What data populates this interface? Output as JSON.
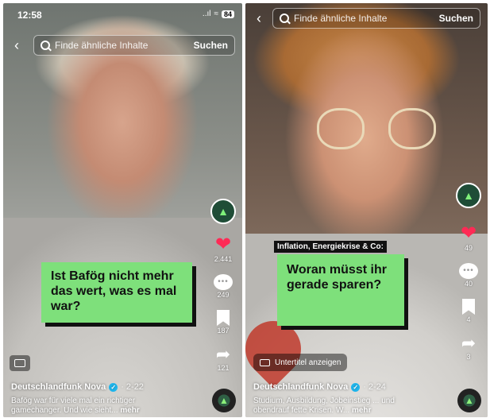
{
  "left": {
    "status": {
      "time": "12:58",
      "signal": "..ıl",
      "wifi": "≈",
      "battery": "84"
    },
    "search": {
      "placeholder": "Finde ähnliche Inhalte",
      "button": "Suchen"
    },
    "caption": "Ist Bafög nicht mehr das wert, was es mal war?",
    "actions": {
      "likes": "2.441",
      "comments": "249",
      "saves": "187",
      "shares": "121"
    },
    "author": "Deutschlandfunk Nova",
    "date": "· 2-22",
    "description": "Bafög war für viele mal ein richtiger gamechanger. Und wie sieht...",
    "more": "mehr"
  },
  "right": {
    "search": {
      "placeholder": "Finde ähnliche Inhalte",
      "button": "Suchen"
    },
    "topic": "Inflation, Energiekrise & Co:",
    "caption": "Woran müsst ihr gerade sparen?",
    "actions": {
      "likes": "49",
      "comments": "40",
      "saves": "4",
      "shares": "3"
    },
    "subtitles": "Untertitel anzeigen",
    "author": "Deutschlandfunk Nova",
    "date": "· 2-24",
    "description": "Studium, Ausbildung, Jobeinstieg ... und obendrauf fette Krisen. W...",
    "more": "mehr"
  },
  "icons": {
    "back": "back-chevron-icon",
    "search": "magnifier-icon",
    "like": "heart-icon",
    "comment": "speech-bubble-icon",
    "save": "bookmark-icon",
    "share": "share-arrow-icon",
    "subtitles": "closed-caption-icon",
    "verified": "verified-badge-icon"
  },
  "colors": {
    "caption_green": "#7ee07b",
    "like_red": "#ff2a55",
    "verified_blue": "#20b7ee"
  }
}
